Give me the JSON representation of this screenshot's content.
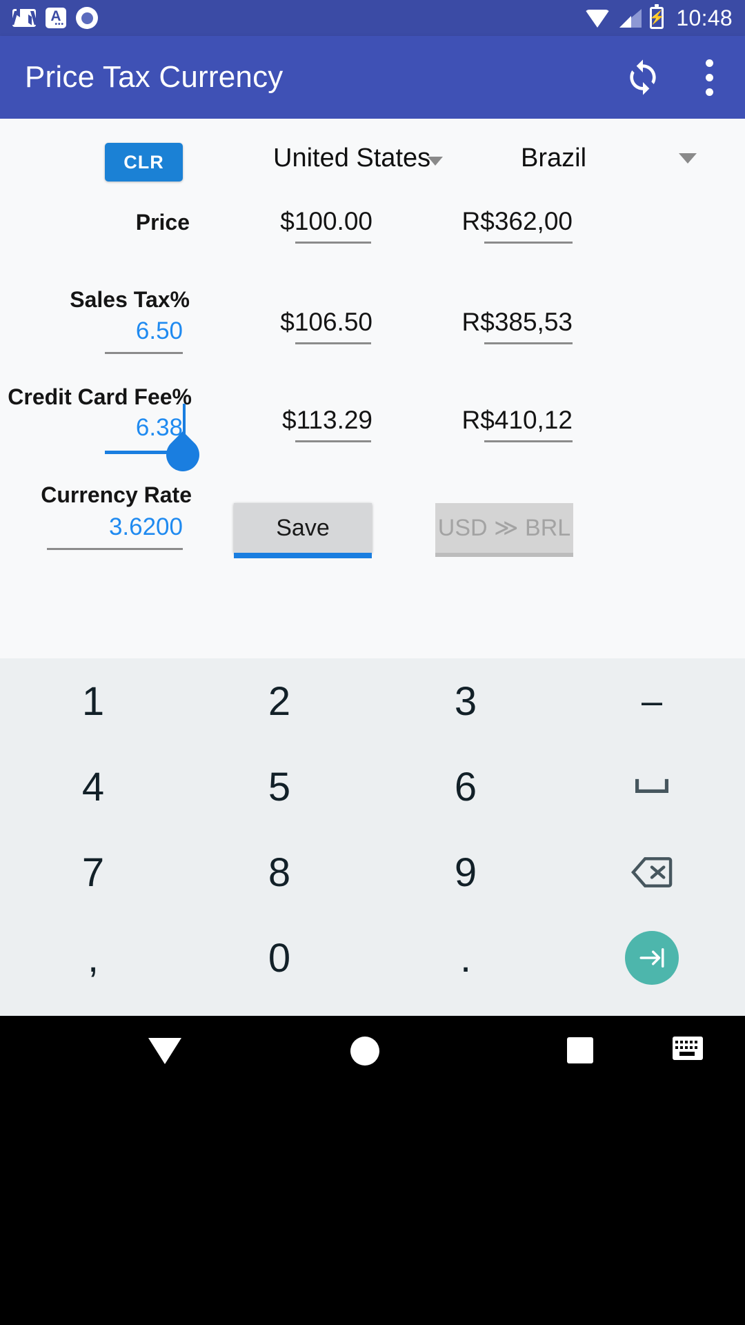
{
  "status_bar": {
    "time": "10:48",
    "left_icons": [
      "gmail-icon",
      "a-app-icon",
      "record-dot-icon"
    ],
    "right_icons": [
      "wifi-icon",
      "cell-signal-icon",
      "battery-charging-icon"
    ],
    "battery_glyph": "⚡",
    "background": "#3b4ba5"
  },
  "app_bar": {
    "title": "Price Tax Currency",
    "sync_label": "sync-icon",
    "overflow_label": "more-options-icon",
    "background": "#3f51b5"
  },
  "toolbar": {
    "clear_label": "CLR",
    "clear_color": "#1b81d5"
  },
  "columns": {
    "source_country": "United States",
    "target_country": "Brazil"
  },
  "rows": [
    {
      "label": "Price",
      "input": "",
      "source_value": "$100.00",
      "target_value": "R$362,00"
    },
    {
      "label": "Sales Tax%",
      "input": "6.50",
      "source_value": "$106.50",
      "target_value": "R$385,53"
    },
    {
      "label": "Credit Card Fee%",
      "input": "6.38",
      "source_value": "$113.29",
      "target_value": "R$410,12"
    },
    {
      "label": "Currency Rate",
      "input": "3.6200",
      "source_value": "",
      "target_value": ""
    }
  ],
  "buttons": {
    "save_label": "Save",
    "convert_label": "USD ≫ BRL",
    "convert_disabled": true
  },
  "accent": {
    "input_text": "#1f8af0",
    "focus_underline": "#1a7ee0",
    "handle": "#1a7ee0"
  },
  "keyboard": {
    "background": "#eceff1",
    "key_color": "#122028",
    "enter_color": "#4db6ac",
    "rows": [
      [
        "1",
        "2",
        "3",
        "–"
      ],
      [
        "4",
        "5",
        "6",
        "␣"
      ],
      [
        "7",
        "8",
        "9",
        "⌫"
      ],
      [
        ",",
        "0",
        ".",
        "⇥"
      ]
    ]
  },
  "nav_bar": {
    "background": "#000000",
    "items": [
      "back-icon",
      "home-icon",
      "recents-icon",
      "keyboard-switch-icon"
    ]
  }
}
